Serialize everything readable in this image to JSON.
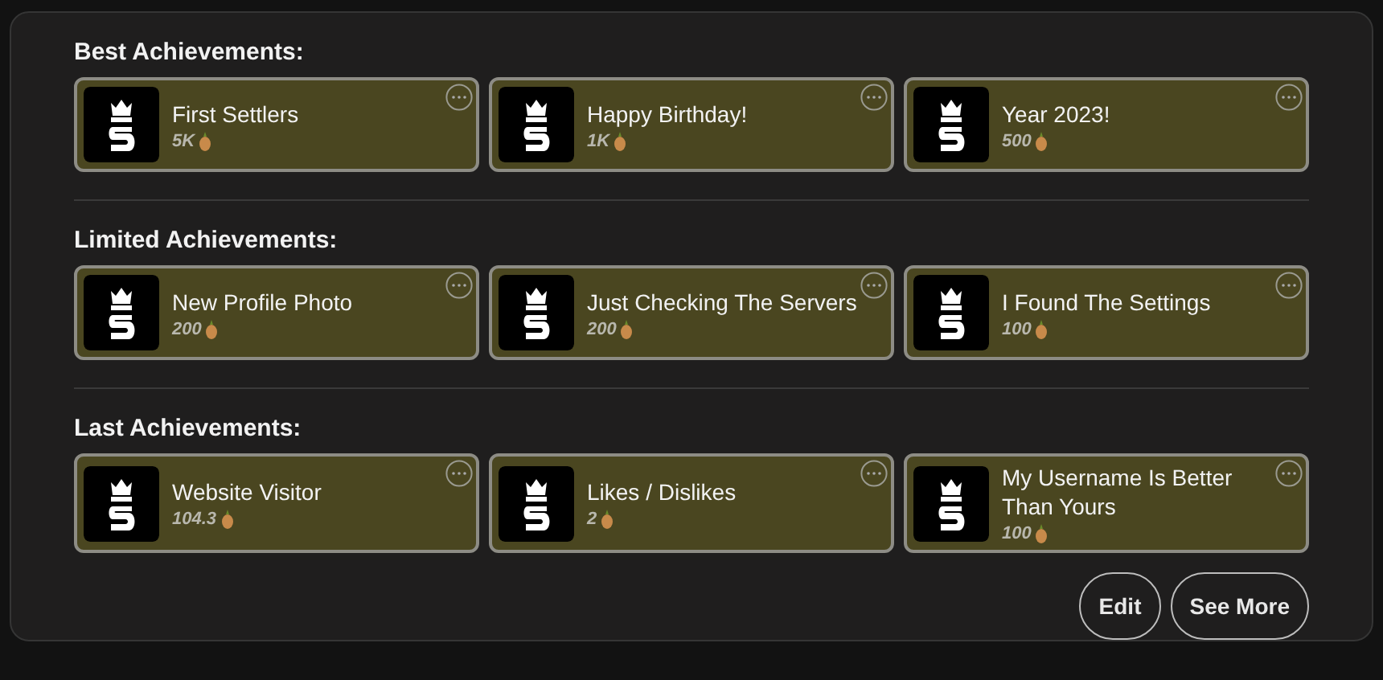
{
  "sections": [
    {
      "title": "Best Achievements:",
      "items": [
        {
          "name": "First Settlers",
          "points": "5K"
        },
        {
          "name": "Happy Birthday!",
          "points": "1K"
        },
        {
          "name": "Year 2023!",
          "points": "500"
        }
      ]
    },
    {
      "title": "Limited Achievements:",
      "items": [
        {
          "name": "New Profile Photo",
          "points": "200"
        },
        {
          "name": "Just Checking The Servers",
          "points": "200"
        },
        {
          "name": "I Found The Settings",
          "points": "100"
        }
      ]
    },
    {
      "title": "Last Achievements:",
      "items": [
        {
          "name": "Website Visitor",
          "points": "104.3"
        },
        {
          "name": "Likes / Dislikes",
          "points": "2"
        },
        {
          "name": "My Username Is Better Than Yours",
          "points": "100"
        }
      ]
    }
  ],
  "buttons": [
    "Edit",
    "See More"
  ]
}
